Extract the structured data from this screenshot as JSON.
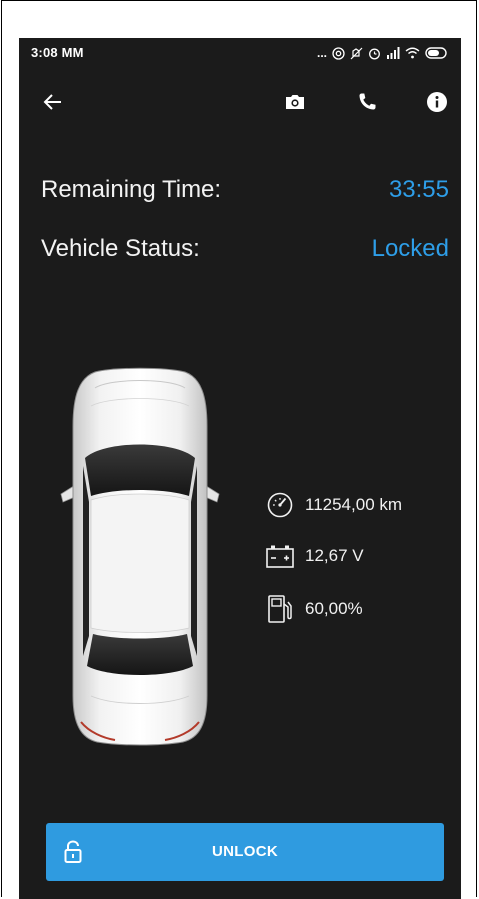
{
  "status_bar": {
    "time": "3:08 MM",
    "dots": "...",
    "icons": [
      "hotspot-icon",
      "mute-icon",
      "alarm-icon",
      "signal-icon",
      "wifi-icon",
      "battery-icon"
    ]
  },
  "toolbar": {
    "icons": [
      "back-arrow-icon",
      "camera-icon",
      "phone-icon",
      "info-icon"
    ]
  },
  "trip": {
    "remaining_label": "Remaining Time:",
    "remaining_value": "33:55",
    "status_label": "Vehicle Status:",
    "status_value": "Locked"
  },
  "stats": {
    "odometer": "11254,00 km",
    "battery": "12,67 V",
    "fuel": "60,00%"
  },
  "action": {
    "unlock_label": "UNLOCK"
  },
  "colors": {
    "background": "#1b1b1b",
    "accent": "#2f9be0",
    "text": "#f3f3f3"
  }
}
